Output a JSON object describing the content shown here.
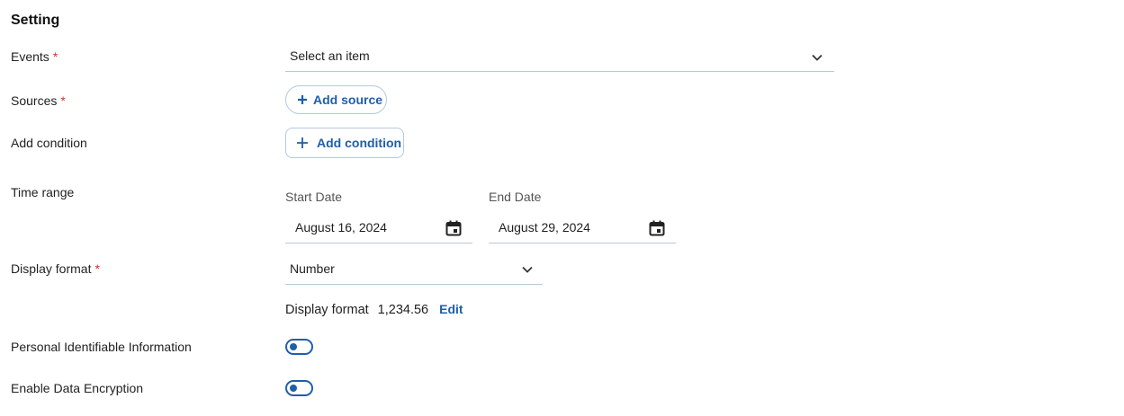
{
  "section_title": "Setting",
  "required_mark": "*",
  "events": {
    "label": "Events",
    "value": "Select an item",
    "icon": "chevron-down-icon"
  },
  "sources": {
    "label": "Sources",
    "button_label": "Add source",
    "icon": "plus-icon"
  },
  "condition": {
    "label": "Add condition",
    "button_label": "Add condition",
    "icon": "plus-icon"
  },
  "time_range": {
    "label": "Time range",
    "start": {
      "caption": "Start Date",
      "value": "August 16, 2024",
      "icon": "calendar-icon"
    },
    "end": {
      "caption": "End Date",
      "value": "August 29, 2024",
      "icon": "calendar-icon"
    }
  },
  "display_format": {
    "label": "Display format",
    "value": "Number",
    "icon": "chevron-down-icon",
    "preview_label": "Display format",
    "preview_value": "1,234.56",
    "edit_label": "Edit"
  },
  "pii": {
    "label": "Personal Identifiable Information",
    "enabled": false
  },
  "encryption": {
    "label": "Enable Data Encryption",
    "enabled": false
  },
  "colors": {
    "accent": "#1f5fa8",
    "required": "#d32f2f",
    "divider": "#b7c9d6"
  }
}
